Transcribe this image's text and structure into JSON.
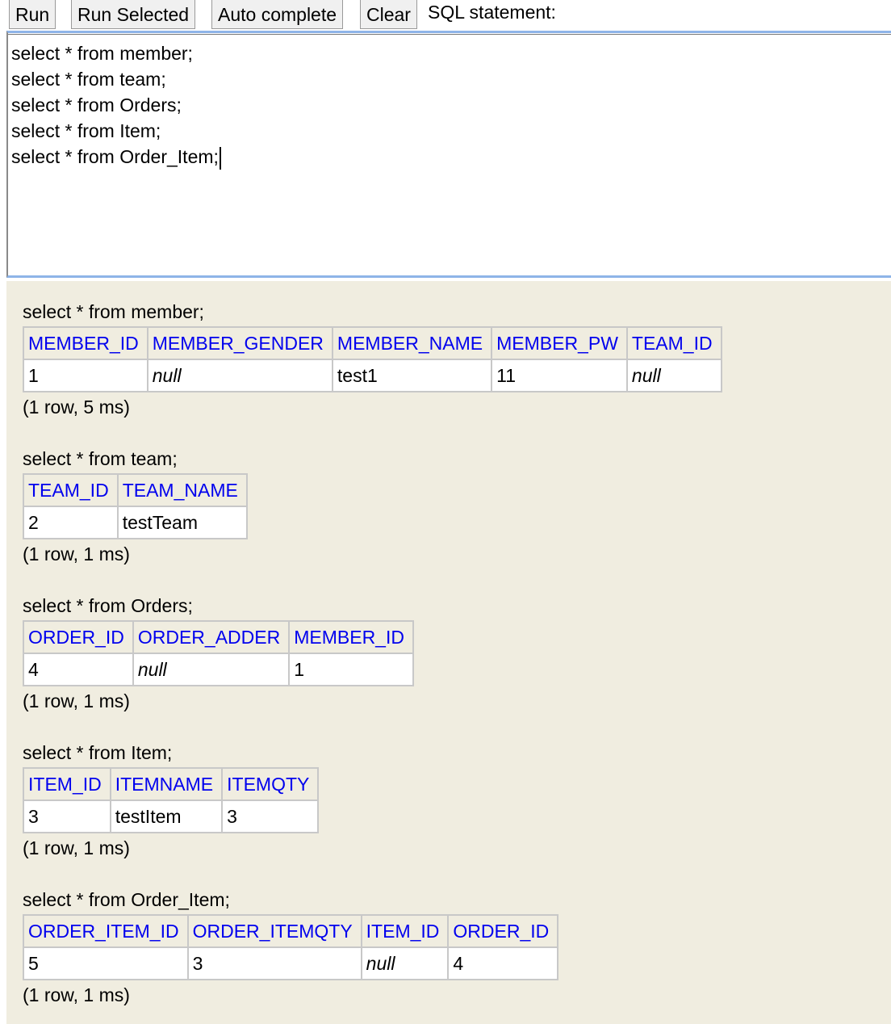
{
  "toolbar": {
    "run_label": "Run",
    "run_selected_label": "Run Selected",
    "auto_complete_label": "Auto complete",
    "clear_label": "Clear",
    "sql_label": "SQL statement:"
  },
  "editor": {
    "lines": [
      "select * from member;",
      "select * from team;",
      "select * from Orders;",
      "select * from Item;",
      "select * from Order_Item;"
    ]
  },
  "results": [
    {
      "query": "select * from member;",
      "columns": [
        "MEMBER_ID",
        "MEMBER_GENDER",
        "MEMBER_NAME",
        "MEMBER_PW",
        "TEAM_ID"
      ],
      "rows": [
        [
          "1",
          "null",
          "test1",
          "11",
          "null"
        ]
      ],
      "status": "(1 row, 5 ms)"
    },
    {
      "query": "select * from team;",
      "columns": [
        "TEAM_ID",
        "TEAM_NAME"
      ],
      "rows": [
        [
          "2",
          "testTeam"
        ]
      ],
      "status": "(1 row, 1 ms)"
    },
    {
      "query": "select * from Orders;",
      "columns": [
        "ORDER_ID",
        "ORDER_ADDER",
        "MEMBER_ID"
      ],
      "rows": [
        [
          "4",
          "null",
          "1"
        ]
      ],
      "status": "(1 row, 1 ms)"
    },
    {
      "query": "select * from Item;",
      "columns": [
        "ITEM_ID",
        "ITEMNAME",
        "ITEMQTY"
      ],
      "rows": [
        [
          "3",
          "testItem",
          "3"
        ]
      ],
      "status": "(1 row, 1 ms)"
    },
    {
      "query": "select * from Order_Item;",
      "columns": [
        "ORDER_ITEM_ID",
        "ORDER_ITEMQTY",
        "ITEM_ID",
        "ORDER_ID"
      ],
      "rows": [
        [
          "5",
          "3",
          "null",
          "4"
        ]
      ],
      "status": "(1 row, 1 ms)"
    }
  ]
}
